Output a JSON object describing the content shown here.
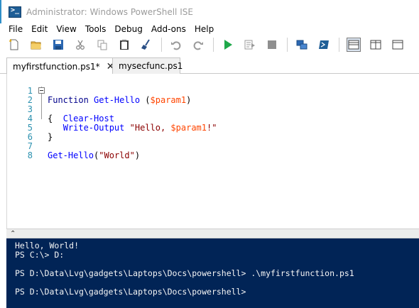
{
  "window": {
    "title": "Administrator: Windows PowerShell ISE"
  },
  "menu": [
    "File",
    "Edit",
    "View",
    "Tools",
    "Debug",
    "Add-ons",
    "Help"
  ],
  "toolbar": {
    "buttons": [
      "new-script",
      "open",
      "save",
      "cut",
      "copy",
      "paste",
      "clear-console",
      "undo",
      "redo",
      "run-script",
      "run-selection",
      "stop",
      "new-remote-tab",
      "start-powershell",
      "show-script-top",
      "show-script-right",
      "show-script-max"
    ]
  },
  "tabs": [
    {
      "label": "myfirstfunction.ps1*",
      "active": true,
      "close": "✕"
    },
    {
      "label": "mysecfunc.ps1",
      "active": false
    }
  ],
  "editor": {
    "lines": [
      {
        "num": "1",
        "tokens": [
          {
            "t": "Function ",
            "c": "kw"
          },
          {
            "t": "Get-Hello",
            "c": "fn"
          },
          {
            "t": " (",
            "c": "plain"
          },
          {
            "t": "$param1",
            "c": "var"
          },
          {
            "t": ")",
            "c": "plain"
          }
        ]
      },
      {
        "num": "2",
        "tokens": [
          {
            "t": "{",
            "c": "plain"
          }
        ]
      },
      {
        "num": "3",
        "tokens": [
          {
            "t": "   ",
            "c": "plain"
          },
          {
            "t": "Clear-Host",
            "c": "fn"
          }
        ]
      },
      {
        "num": "4",
        "tokens": [
          {
            "t": "   ",
            "c": "plain"
          },
          {
            "t": "Write-Output",
            "c": "fn"
          },
          {
            "t": " ",
            "c": "plain"
          },
          {
            "t": "\"Hello, ",
            "c": "str"
          },
          {
            "t": "$param1",
            "c": "var"
          },
          {
            "t": "!\"",
            "c": "str"
          }
        ]
      },
      {
        "num": "5",
        "tokens": [
          {
            "t": "}",
            "c": "plain"
          }
        ]
      },
      {
        "num": "6",
        "tokens": []
      },
      {
        "num": "7",
        "tokens": [
          {
            "t": "Get-Hello",
            "c": "fn"
          },
          {
            "t": "(",
            "c": "plain"
          },
          {
            "t": "\"World\"",
            "c": "str"
          },
          {
            "t": ")",
            "c": "plain"
          }
        ]
      },
      {
        "num": "8",
        "tokens": []
      }
    ]
  },
  "splitter": {
    "collapse_glyph": "⌃"
  },
  "console": {
    "lines": [
      "Hello, World!",
      "PS C:\\> D:",
      "",
      "PS D:\\Data\\Lvg\\gadgets\\Laptops\\Docs\\powershell> .\\myfirstfunction.ps1",
      "",
      "PS D:\\Data\\Lvg\\gadgets\\Laptops\\Docs\\powershell>"
    ]
  },
  "colors": {
    "console_bg": "#012456",
    "line_numbers": "#2b91af",
    "keyword": "#00008b",
    "command": "#0000ff",
    "variable": "#ff4500",
    "string": "#8b0000"
  }
}
